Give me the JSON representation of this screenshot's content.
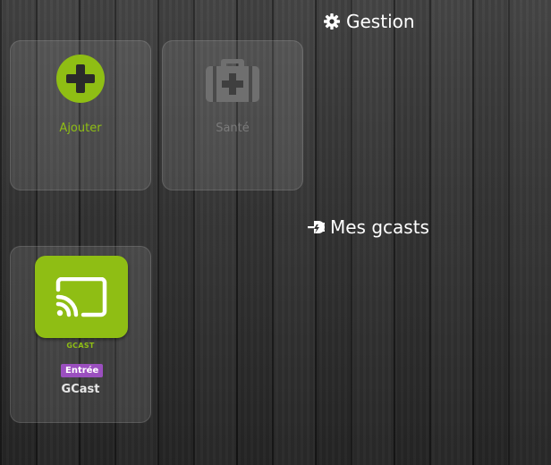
{
  "sections": {
    "gestion": {
      "title": "Gestion",
      "icon": "gear-icon"
    },
    "gcasts": {
      "title": "Mes gcasts",
      "icon": "plug-icon"
    }
  },
  "tiles": {
    "ajouter": {
      "label": "Ajouter",
      "icon": "plus-circle-icon",
      "color": "#8fbe14"
    },
    "sante": {
      "label": "Santé",
      "icon": "medical-kit-icon",
      "color": "#7a7a7a"
    }
  },
  "gcast_card": {
    "brand": "GCAST",
    "badge": "Entrée",
    "name": "GCast",
    "icon": "cast-icon",
    "accent": "#8fbe14",
    "badge_color": "#9b4fbf"
  }
}
